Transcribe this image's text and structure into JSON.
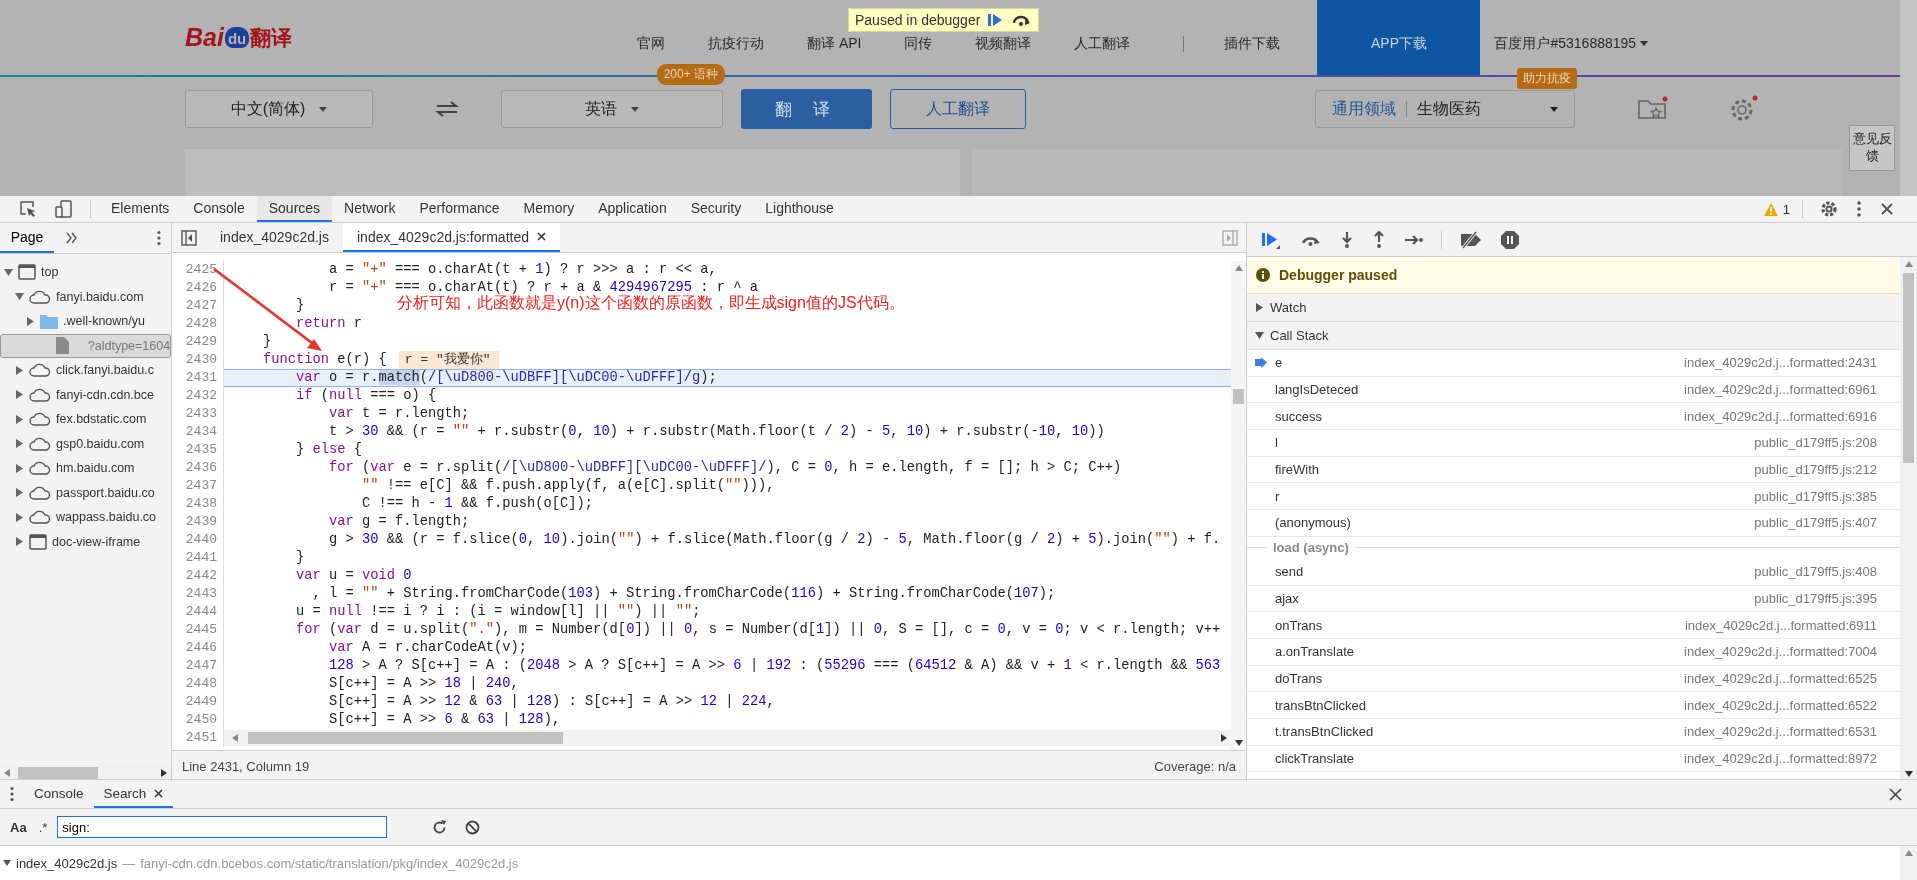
{
  "page": {
    "logo": {
      "prefix": "Bai",
      "paw_text": "du",
      "suffix": "翻译"
    },
    "nav_left": [
      "官网",
      "抗疫行动",
      "翻译 API",
      "同传",
      "视频翻译",
      "人工翻译"
    ],
    "nav_right": [
      "插件下载"
    ],
    "app_button": "APP下载",
    "user_menu": "百度用户#5316888195",
    "source_language": "中文(简体)",
    "target_language": "英语",
    "language_badge": "200+ 语种",
    "translate_button": "翻 译",
    "human_translate_button": "人工翻译",
    "domain": {
      "badge": "助力抗疫",
      "field": "通用领域",
      "value": "生物医药"
    },
    "feedback": "意见反馈"
  },
  "debugger_badge": {
    "text": "Paused in debugger"
  },
  "devtools": {
    "tabs": [
      {
        "label": "Elements",
        "selected": false
      },
      {
        "label": "Console",
        "selected": false
      },
      {
        "label": "Sources",
        "selected": true
      },
      {
        "label": "Network",
        "selected": false
      },
      {
        "label": "Performance",
        "selected": false
      },
      {
        "label": "Memory",
        "selected": false
      },
      {
        "label": "Application",
        "selected": false
      },
      {
        "label": "Security",
        "selected": false
      },
      {
        "label": "Lighthouse",
        "selected": false
      }
    ],
    "warnings": "1",
    "navigator": {
      "tabs": [
        {
          "label": "Page",
          "selected": true
        }
      ],
      "tree": [
        {
          "label": "top",
          "kind": "frame",
          "expanded": true,
          "children": [
            {
              "label": "fanyi.baidu.com",
              "kind": "domain",
              "expanded": true,
              "selected": false,
              "children": [
                {
                  "label": ".well-known/yu",
                  "kind": "folder",
                  "expanded": false,
                  "selected": false
                },
                {
                  "label": "?aldtype=1604",
                  "kind": "file",
                  "selected": true
                }
              ]
            },
            {
              "label": "click.fanyi.baidu.c",
              "kind": "domain",
              "expanded": false,
              "selected": false
            },
            {
              "label": "fanyi-cdn.cdn.bce",
              "kind": "domain",
              "expanded": false,
              "selected": false
            },
            {
              "label": "fex.bdstatic.com",
              "kind": "domain",
              "expanded": false,
              "selected": false
            },
            {
              "label": "gsp0.baidu.com",
              "kind": "domain",
              "expanded": false,
              "selected": false
            },
            {
              "label": "hm.baidu.com",
              "kind": "domain",
              "expanded": false,
              "selected": false
            },
            {
              "label": "passport.baidu.co",
              "kind": "domain",
              "expanded": false,
              "selected": false
            },
            {
              "label": "wappass.baidu.co",
              "kind": "domain",
              "expanded": false,
              "selected": false
            },
            {
              "label": "doc-view-iframe",
              "kind": "frame",
              "expanded": false,
              "selected": false
            }
          ]
        }
      ]
    },
    "editor": {
      "tabs": [
        {
          "label": "index_4029c2d.js",
          "selected": false,
          "closable": false
        },
        {
          "label": "index_4029c2d.js:formatted",
          "selected": true,
          "closable": true
        }
      ],
      "lines": [
        {
          "n": "2425",
          "code": [
            {
              "text": "            a = ",
              "kind": "plain"
            },
            {
              "text": "\"+\"",
              "kind": "string"
            },
            {
              "text": " === o.charAt(t + ",
              "kind": "plain"
            },
            {
              "text": "1",
              "kind": "number"
            },
            {
              "text": ") ? r >>> a : r << a,",
              "kind": "plain"
            }
          ]
        },
        {
          "n": "2426",
          "code": [
            {
              "text": "            r = ",
              "kind": "plain"
            },
            {
              "text": "\"+\"",
              "kind": "string"
            },
            {
              "text": " === o.charAt(t) ? r + a & ",
              "kind": "plain"
            },
            {
              "text": "4294967295",
              "kind": "number"
            },
            {
              "text": " : r ^ a",
              "kind": "plain"
            }
          ]
        },
        {
          "n": "2427",
          "code": [
            {
              "text": "        }",
              "kind": "plain"
            }
          ]
        },
        {
          "n": "2428",
          "code": [
            {
              "text": "        return",
              "kind": "keyword"
            },
            {
              "text": " r",
              "kind": "plain"
            }
          ]
        },
        {
          "n": "2429",
          "code": [
            {
              "text": "    }",
              "kind": "plain"
            }
          ]
        },
        {
          "n": "2430",
          "code": [
            {
              "text": "    function",
              "kind": "keyword"
            },
            {
              "text": " e(r) {",
              "kind": "plain"
            }
          ],
          "inline_value": "r = \"我爱你\""
        },
        {
          "n": "2431",
          "current": true,
          "code": [
            {
              "text": "        var",
              "kind": "keyword"
            },
            {
              "text": " o = r.",
              "kind": "plain"
            },
            {
              "text": "match",
              "kind": "selection"
            },
            {
              "text": "(",
              "kind": "plain"
            },
            {
              "text": "/[\\uD800-\\uDBFF][\\uDC00-\\uDFFF]/g",
              "kind": "regex"
            },
            {
              "text": ");",
              "kind": "plain"
            }
          ]
        },
        {
          "n": "2432",
          "code": [
            {
              "text": "        if",
              "kind": "keyword"
            },
            {
              "text": " (",
              "kind": "plain"
            },
            {
              "text": "null",
              "kind": "keyword"
            },
            {
              "text": " === o) {",
              "kind": "plain"
            }
          ]
        },
        {
          "n": "2433",
          "code": [
            {
              "text": "            var",
              "kind": "keyword"
            },
            {
              "text": " t = r.length;",
              "kind": "plain"
            }
          ]
        },
        {
          "n": "2434",
          "code": [
            {
              "text": "            t > ",
              "kind": "plain"
            },
            {
              "text": "30",
              "kind": "number"
            },
            {
              "text": " && (r = ",
              "kind": "plain"
            },
            {
              "text": "\"\"",
              "kind": "string"
            },
            {
              "text": " + r.substr(",
              "kind": "plain"
            },
            {
              "text": "0",
              "kind": "number"
            },
            {
              "text": ", ",
              "kind": "plain"
            },
            {
              "text": "10",
              "kind": "number"
            },
            {
              "text": ") + r.substr(Math.floor(t / ",
              "kind": "plain"
            },
            {
              "text": "2",
              "kind": "number"
            },
            {
              "text": ") - ",
              "kind": "plain"
            },
            {
              "text": "5",
              "kind": "number"
            },
            {
              "text": ", ",
              "kind": "plain"
            },
            {
              "text": "10",
              "kind": "number"
            },
            {
              "text": ") + r.substr(-",
              "kind": "plain"
            },
            {
              "text": "10",
              "kind": "number"
            },
            {
              "text": ", ",
              "kind": "plain"
            },
            {
              "text": "10",
              "kind": "number"
            },
            {
              "text": "))",
              "kind": "plain"
            }
          ]
        },
        {
          "n": "2435",
          "code": [
            {
              "text": "        } ",
              "kind": "plain"
            },
            {
              "text": "else",
              "kind": "keyword"
            },
            {
              "text": " {",
              "kind": "plain"
            }
          ]
        },
        {
          "n": "2436",
          "code": [
            {
              "text": "            for",
              "kind": "keyword"
            },
            {
              "text": " (",
              "kind": "plain"
            },
            {
              "text": "var",
              "kind": "keyword"
            },
            {
              "text": " e = r.split(",
              "kind": "plain"
            },
            {
              "text": "/[\\uD800-\\uDBFF][\\uDC00-\\uDFFF]/",
              "kind": "regex"
            },
            {
              "text": "), C = ",
              "kind": "plain"
            },
            {
              "text": "0",
              "kind": "number"
            },
            {
              "text": ", h = e.length, f = []; h > C; C++)",
              "kind": "plain"
            }
          ]
        },
        {
          "n": "2437",
          "code": [
            {
              "text": "                \"\"",
              "kind": "string"
            },
            {
              "text": " !== e[C] && f.push.apply(f, a(e[C].split(",
              "kind": "plain"
            },
            {
              "text": "\"\"",
              "kind": "string"
            },
            {
              "text": "))),",
              "kind": "plain"
            }
          ]
        },
        {
          "n": "2438",
          "code": [
            {
              "text": "                C !== h - ",
              "kind": "plain"
            },
            {
              "text": "1",
              "kind": "number"
            },
            {
              "text": " && f.push(o[C]);",
              "kind": "plain"
            }
          ]
        },
        {
          "n": "2439",
          "code": [
            {
              "text": "            var",
              "kind": "keyword"
            },
            {
              "text": " g = f.length;",
              "kind": "plain"
            }
          ]
        },
        {
          "n": "2440",
          "code": [
            {
              "text": "            g > ",
              "kind": "plain"
            },
            {
              "text": "30",
              "kind": "number"
            },
            {
              "text": " && (r = f.slice(",
              "kind": "plain"
            },
            {
              "text": "0",
              "kind": "number"
            },
            {
              "text": ", ",
              "kind": "plain"
            },
            {
              "text": "10",
              "kind": "number"
            },
            {
              "text": ").join(",
              "kind": "plain"
            },
            {
              "text": "\"\"",
              "kind": "string"
            },
            {
              "text": ") + f.slice(Math.floor(g / ",
              "kind": "plain"
            },
            {
              "text": "2",
              "kind": "number"
            },
            {
              "text": ") - ",
              "kind": "plain"
            },
            {
              "text": "5",
              "kind": "number"
            },
            {
              "text": ", Math.floor(g / ",
              "kind": "plain"
            },
            {
              "text": "2",
              "kind": "number"
            },
            {
              "text": ") + ",
              "kind": "plain"
            },
            {
              "text": "5",
              "kind": "number"
            },
            {
              "text": ").join(",
              "kind": "plain"
            },
            {
              "text": "\"\"",
              "kind": "string"
            },
            {
              "text": ") + f.",
              "kind": "plain"
            }
          ]
        },
        {
          "n": "2441",
          "code": [
            {
              "text": "        }",
              "kind": "plain"
            }
          ]
        },
        {
          "n": "2442",
          "code": [
            {
              "text": "        var",
              "kind": "keyword"
            },
            {
              "text": " u = ",
              "kind": "plain"
            },
            {
              "text": "void",
              "kind": "keyword"
            },
            {
              "text": " 0",
              "kind": "number"
            }
          ]
        },
        {
          "n": "2443",
          "code": [
            {
              "text": "          , l = ",
              "kind": "plain"
            },
            {
              "text": "\"\"",
              "kind": "string"
            },
            {
              "text": " + String.fromCharCode(",
              "kind": "plain"
            },
            {
              "text": "103",
              "kind": "number"
            },
            {
              "text": ") + String.fromCharCode(",
              "kind": "plain"
            },
            {
              "text": "116",
              "kind": "number"
            },
            {
              "text": ") + String.fromCharCode(",
              "kind": "plain"
            },
            {
              "text": "107",
              "kind": "number"
            },
            {
              "text": ");",
              "kind": "plain"
            }
          ]
        },
        {
          "n": "2444",
          "code": [
            {
              "text": "        u = ",
              "kind": "plain"
            },
            {
              "text": "null",
              "kind": "keyword"
            },
            {
              "text": " !== i ? i : (i = window[l] || ",
              "kind": "plain"
            },
            {
              "text": "\"\"",
              "kind": "string"
            },
            {
              "text": ") || ",
              "kind": "plain"
            },
            {
              "text": "\"\"",
              "kind": "string"
            },
            {
              "text": ";",
              "kind": "plain"
            }
          ]
        },
        {
          "n": "2445",
          "code": [
            {
              "text": "        for",
              "kind": "keyword"
            },
            {
              "text": " (",
              "kind": "plain"
            },
            {
              "text": "var",
              "kind": "keyword"
            },
            {
              "text": " d = u.split(",
              "kind": "plain"
            },
            {
              "text": "\".\"",
              "kind": "string"
            },
            {
              "text": "), m = Number(d[",
              "kind": "plain"
            },
            {
              "text": "0",
              "kind": "number"
            },
            {
              "text": "]) || ",
              "kind": "plain"
            },
            {
              "text": "0",
              "kind": "number"
            },
            {
              "text": ", s = Number(d[",
              "kind": "plain"
            },
            {
              "text": "1",
              "kind": "number"
            },
            {
              "text": "]) || ",
              "kind": "plain"
            },
            {
              "text": "0",
              "kind": "number"
            },
            {
              "text": ", S = [], c = ",
              "kind": "plain"
            },
            {
              "text": "0",
              "kind": "number"
            },
            {
              "text": ", v = ",
              "kind": "plain"
            },
            {
              "text": "0",
              "kind": "number"
            },
            {
              "text": "; v < r.length; v++",
              "kind": "plain"
            }
          ]
        },
        {
          "n": "2446",
          "code": [
            {
              "text": "            var",
              "kind": "keyword"
            },
            {
              "text": " A = r.charCodeAt(v);",
              "kind": "plain"
            }
          ]
        },
        {
          "n": "2447",
          "code": [
            {
              "text": "            128",
              "kind": "number"
            },
            {
              "text": " > A ? S[c++] = A : (",
              "kind": "plain"
            },
            {
              "text": "2048",
              "kind": "number"
            },
            {
              "text": " > A ? S[c++] = A >> ",
              "kind": "plain"
            },
            {
              "text": "6",
              "kind": "number"
            },
            {
              "text": " | ",
              "kind": "plain"
            },
            {
              "text": "192",
              "kind": "number"
            },
            {
              "text": " : (",
              "kind": "plain"
            },
            {
              "text": "55296",
              "kind": "number"
            },
            {
              "text": " === (",
              "kind": "plain"
            },
            {
              "text": "64512",
              "kind": "number"
            },
            {
              "text": " & A) && v + ",
              "kind": "plain"
            },
            {
              "text": "1",
              "kind": "number"
            },
            {
              "text": " < r.length && ",
              "kind": "plain"
            },
            {
              "text": "563",
              "kind": "number"
            }
          ]
        },
        {
          "n": "2448",
          "code": [
            {
              "text": "            S[c++] = A >> ",
              "kind": "plain"
            },
            {
              "text": "18",
              "kind": "number"
            },
            {
              "text": " | ",
              "kind": "plain"
            },
            {
              "text": "240",
              "kind": "number"
            },
            {
              "text": ",",
              "kind": "plain"
            }
          ]
        },
        {
          "n": "2449",
          "code": [
            {
              "text": "            S[c++] = A >> ",
              "kind": "plain"
            },
            {
              "text": "12",
              "kind": "number"
            },
            {
              "text": " & ",
              "kind": "plain"
            },
            {
              "text": "63",
              "kind": "number"
            },
            {
              "text": " | ",
              "kind": "plain"
            },
            {
              "text": "128",
              "kind": "number"
            },
            {
              "text": ") : S[c++] = A >> ",
              "kind": "plain"
            },
            {
              "text": "12",
              "kind": "number"
            },
            {
              "text": " | ",
              "kind": "plain"
            },
            {
              "text": "224",
              "kind": "number"
            },
            {
              "text": ",",
              "kind": "plain"
            }
          ]
        },
        {
          "n": "2450",
          "code": [
            {
              "text": "            S[c++] = A >> ",
              "kind": "plain"
            },
            {
              "text": "6",
              "kind": "number"
            },
            {
              "text": " & ",
              "kind": "plain"
            },
            {
              "text": "63",
              "kind": "number"
            },
            {
              "text": " | ",
              "kind": "plain"
            },
            {
              "text": "128",
              "kind": "number"
            },
            {
              "text": "),",
              "kind": "plain"
            }
          ]
        },
        {
          "n": "2451"
        }
      ],
      "annotation": "分析可知，此函数就是y(n)这个函数的原函数，即生成sign值的JS代码。",
      "status": "Line 2431, Column 19",
      "coverage": "Coverage: n/a"
    },
    "debugger": {
      "banner": "Debugger paused",
      "sections": [
        {
          "label": "Watch",
          "expanded": false
        },
        {
          "label": "Call Stack",
          "expanded": true
        }
      ],
      "call_stack": [
        {
          "kind": "frame",
          "name": "e",
          "location": "index_4029c2d.j...formatted:2431",
          "current": true
        },
        {
          "kind": "frame",
          "name": "langIsDeteced",
          "location": "index_4029c2d.j...formatted:6961",
          "current": false
        },
        {
          "kind": "frame",
          "name": "success",
          "location": "index_4029c2d.j...formatted:6916",
          "current": false
        },
        {
          "kind": "frame",
          "name": "l",
          "location": "public_d179ff5.js:208",
          "current": false
        },
        {
          "kind": "frame",
          "name": "fireWith",
          "location": "public_d179ff5.js:212",
          "current": false
        },
        {
          "kind": "frame",
          "name": "r",
          "location": "public_d179ff5.js:385",
          "current": false
        },
        {
          "kind": "frame",
          "name": "(anonymous)",
          "location": "public_d179ff5.js:407",
          "current": false
        },
        {
          "kind": "async",
          "name": "load (async)"
        },
        {
          "kind": "frame",
          "name": "send",
          "location": "public_d179ff5.js:408",
          "current": false
        },
        {
          "kind": "frame",
          "name": "ajax",
          "location": "public_d179ff5.js:395",
          "current": false
        },
        {
          "kind": "frame",
          "name": "onTrans",
          "location": "index_4029c2d.j...formatted:6911",
          "current": false
        },
        {
          "kind": "frame",
          "name": "a.onTranslate",
          "location": "index_4029c2d.j...formatted:7004",
          "current": false
        },
        {
          "kind": "frame",
          "name": "doTrans",
          "location": "index_4029c2d.j...formatted:6525",
          "current": false
        },
        {
          "kind": "frame",
          "name": "transBtnClicked",
          "location": "index_4029c2d.j...formatted:6522",
          "current": false
        },
        {
          "kind": "frame",
          "name": "t.transBtnClicked",
          "location": "index_4029c2d.j...formatted:6531",
          "current": false
        },
        {
          "kind": "frame",
          "name": "clickTranslate",
          "location": "index_4029c2d.j...formatted:8972",
          "current": false
        }
      ]
    },
    "drawer": {
      "tabs": [
        {
          "label": "Console",
          "selected": false,
          "closable": false
        },
        {
          "label": "Search",
          "selected": true,
          "closable": true
        }
      ],
      "search": {
        "case_label": "Aa",
        "regex_label": ".*",
        "value": "sign:"
      },
      "results": [
        {
          "file": "index_4029c2d.js",
          "separator": "—",
          "path": "fanyi-cdn.cdn.bcebos.com/static/translation/pkg/index_4029c2d.js",
          "expanded": true
        }
      ]
    }
  }
}
